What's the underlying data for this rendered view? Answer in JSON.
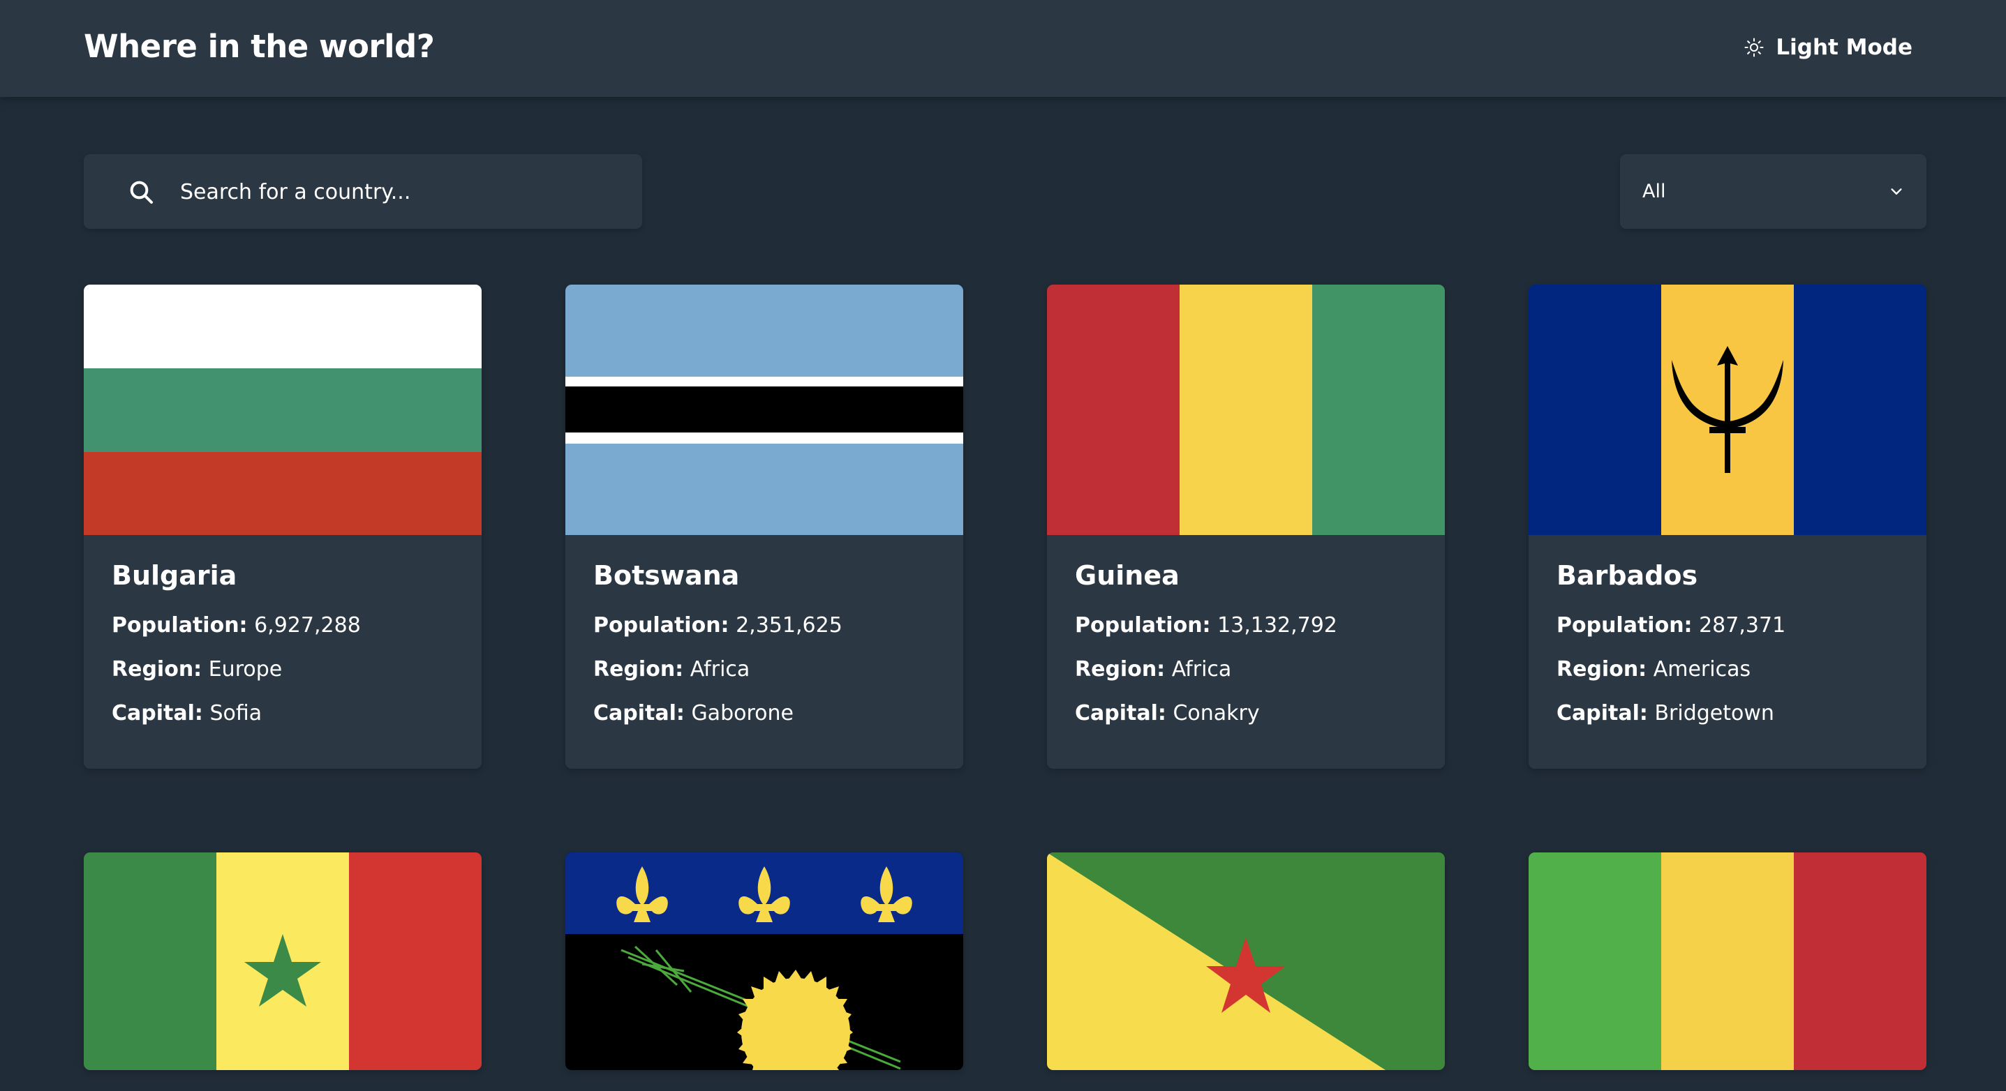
{
  "header": {
    "title": "Where in the world?",
    "theme_toggle_label": "Light Mode",
    "theme_icon": "sun-icon"
  },
  "search": {
    "placeholder": "Search for a country...",
    "value": "",
    "icon": "search-icon"
  },
  "filter": {
    "selected": "All",
    "icon": "chevron-down-icon"
  },
  "labels": {
    "population": "Population:",
    "region": "Region:",
    "capital": "Capital:"
  },
  "countries": [
    {
      "name": "Bulgaria",
      "population": "6,927,288",
      "region": "Europe",
      "capital": "Sofia",
      "flag": "flag-bulgaria"
    },
    {
      "name": "Botswana",
      "population": "2,351,625",
      "region": "Africa",
      "capital": "Gaborone",
      "flag": "flag-botswana"
    },
    {
      "name": "Guinea",
      "population": "13,132,792",
      "region": "Africa",
      "capital": "Conakry",
      "flag": "flag-guinea"
    },
    {
      "name": "Barbados",
      "population": "287,371",
      "region": "Americas",
      "capital": "Bridgetown",
      "flag": "flag-barbados"
    }
  ],
  "partial_flags": [
    "flag-senegal",
    "flag-guadeloupe",
    "flag-french-guiana",
    "flag-mali"
  ],
  "colors": {
    "background": "#202c37",
    "surface": "#2b3743",
    "text": "#ffffff"
  }
}
